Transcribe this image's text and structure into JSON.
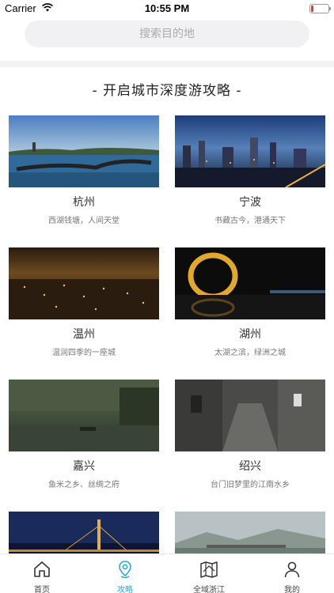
{
  "status": {
    "carrier": "Carrier",
    "time": "10:55 PM"
  },
  "search": {
    "placeholder": "搜索目的地"
  },
  "section": {
    "title": "- 开启城市深度游攻略 -"
  },
  "cities": [
    {
      "name": "杭州",
      "desc": "西湖钱塘，人间天堂"
    },
    {
      "name": "宁波",
      "desc": "书藏古今，港通天下"
    },
    {
      "name": "温州",
      "desc": "温润四季的一座城"
    },
    {
      "name": "湖州",
      "desc": "太湖之滨，绿洲之城"
    },
    {
      "name": "嘉兴",
      "desc": "鱼米之乡、丝绸之府"
    },
    {
      "name": "绍兴",
      "desc": "台门旧梦里的江南水乡"
    }
  ],
  "tabs": [
    {
      "label": "首页",
      "icon": "home-icon"
    },
    {
      "label": "攻略",
      "icon": "location-pin-icon"
    },
    {
      "label": "全域浙江",
      "icon": "map-icon"
    },
    {
      "label": "我的",
      "icon": "person-icon"
    }
  ],
  "colors": {
    "accent": "#2aa7de",
    "search_bg": "#f1f1f3",
    "divider": "#f3f3f5"
  }
}
